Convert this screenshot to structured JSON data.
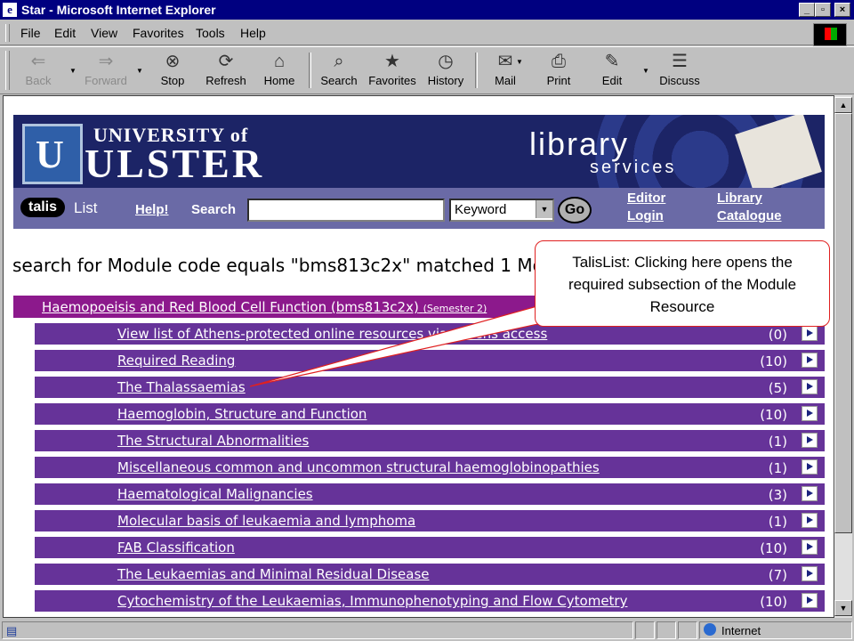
{
  "window": {
    "title": "Star - Microsoft Internet Explorer",
    "controls": [
      "_",
      "▫",
      "×"
    ]
  },
  "menu": [
    "File",
    "Edit",
    "View",
    "Favorites",
    "Tools",
    "Help"
  ],
  "toolbar": [
    {
      "label": "Back",
      "icon": "back-arrow-icon",
      "enabled": false
    },
    {
      "label": "Forward",
      "icon": "forward-arrow-icon",
      "enabled": false
    },
    {
      "label": "Stop",
      "icon": "stop-icon",
      "enabled": true
    },
    {
      "label": "Refresh",
      "icon": "refresh-icon",
      "enabled": true
    },
    {
      "label": "Home",
      "icon": "home-icon",
      "enabled": true
    },
    {
      "label": "Search",
      "icon": "search-icon",
      "enabled": true
    },
    {
      "label": "Favorites",
      "icon": "favorites-icon",
      "enabled": true
    },
    {
      "label": "History",
      "icon": "history-icon",
      "enabled": true
    },
    {
      "label": "Mail",
      "icon": "mail-icon",
      "enabled": true
    },
    {
      "label": "Print",
      "icon": "print-icon",
      "enabled": true
    },
    {
      "label": "Edit",
      "icon": "edit-icon",
      "enabled": true
    },
    {
      "label": "Discuss",
      "icon": "discuss-icon",
      "enabled": true
    }
  ],
  "banner": {
    "uni_line1": "UNIVERSITY of",
    "uni_line2": "ULSTER",
    "logo_letter": "U",
    "library": "library",
    "services": "services"
  },
  "nav": {
    "talis": "talis",
    "list": "List",
    "help": "Help!",
    "search_label": "Search",
    "search_value": "",
    "select_value": "Keyword",
    "go": "Go",
    "editor": "Editor",
    "login": "Login",
    "library": "Library",
    "catalogue": "Catalogue"
  },
  "search_heading": "search for Module code equals \"bms813c2x\" matched 1 Module",
  "module": {
    "title": "Haemopoeisis and Red Blood Cell Function (bms813c2x)",
    "semester": "(Semester 2)"
  },
  "sections": [
    {
      "title": "View list of Athens-protected online resources via Athens access",
      "count": "(0)"
    },
    {
      "title": "Required Reading",
      "count": "(10)"
    },
    {
      "title": "The Thalassaemias",
      "count": "(5)"
    },
    {
      "title": "Haemoglobin, Structure and Function",
      "count": "(10)"
    },
    {
      "title": "The Structural Abnormalities",
      "count": "(1)"
    },
    {
      "title": "Miscellaneous common and uncommon structural haemoglobinopathies",
      "count": "(1)"
    },
    {
      "title": "Haematological Malignancies",
      "count": "(3)"
    },
    {
      "title": "Molecular basis of leukaemia and lymphoma",
      "count": "(1)"
    },
    {
      "title": "FAB Classification",
      "count": "(10)"
    },
    {
      "title": "The Leukaemias and Minimal Residual Disease",
      "count": "(7)"
    },
    {
      "title": "Cytochemistry of the Leukaemias, Immunophenotyping and Flow Cytometry",
      "count": "(10)"
    }
  ],
  "callout": "TalisList: Clicking here opens the required subsection of the Module Resource",
  "status": {
    "zone": "Internet"
  },
  "colors": {
    "title_bar": "#000080",
    "banner": "#1c2466",
    "nav_strip": "#6a6aa6",
    "module_row": "#8c198c",
    "section_row": "#663399",
    "callout_border": "#e02020"
  }
}
